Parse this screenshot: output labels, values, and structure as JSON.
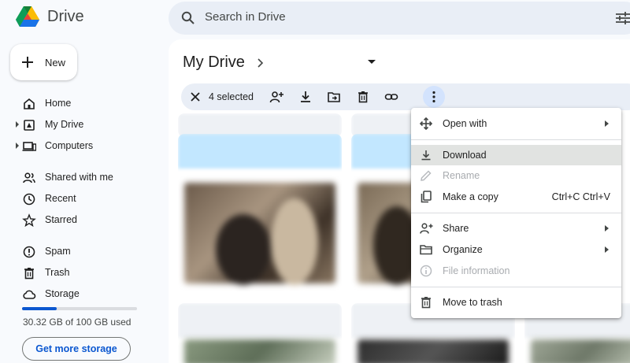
{
  "app": {
    "title": "Drive"
  },
  "search": {
    "placeholder": "Search in Drive"
  },
  "new_button": {
    "label": "New"
  },
  "nav": {
    "home": "Home",
    "my_drive": "My Drive",
    "computers": "Computers",
    "shared": "Shared with me",
    "recent": "Recent",
    "starred": "Starred",
    "spam": "Spam",
    "trash": "Trash",
    "storage": "Storage"
  },
  "storage": {
    "used_text": "30.32 GB of 100 GB used",
    "used_fraction": 0.3032,
    "cta": "Get more storage"
  },
  "main": {
    "title": "My Drive"
  },
  "selection": {
    "count": "4 selected"
  },
  "menu": {
    "open_with": "Open with",
    "download": "Download",
    "rename": "Rename",
    "make_copy": "Make a copy",
    "make_copy_shortcut": "Ctrl+C Ctrl+V",
    "share": "Share",
    "organize": "Organize",
    "file_info": "File information",
    "move_trash": "Move to trash"
  },
  "colors": {
    "accent": "#0b57d0",
    "selection_bar": "#e9eef6",
    "highlight": "#e1e3e1"
  }
}
